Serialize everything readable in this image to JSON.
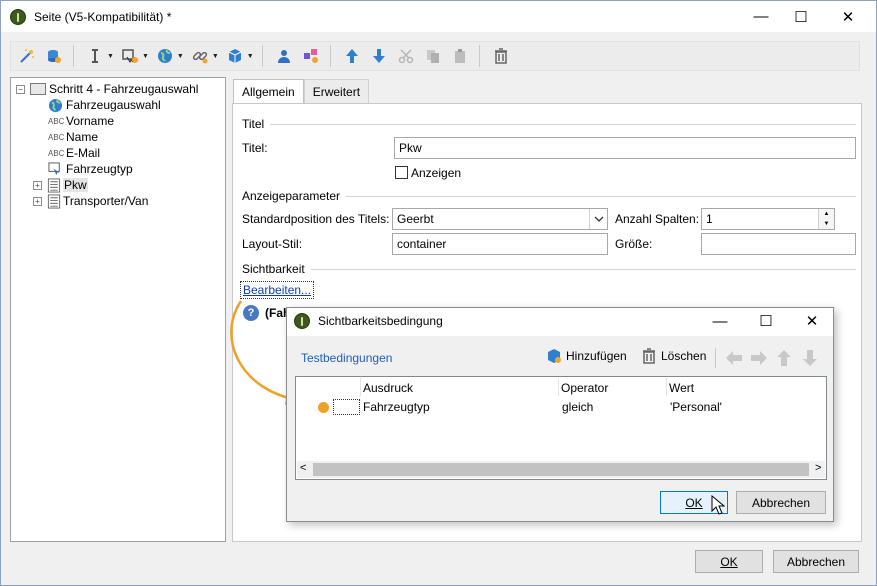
{
  "window": {
    "title": "Seite (V5-Kompatibilität) *",
    "minimize_glyph": "—",
    "maximize_glyph": "☐",
    "close_glyph": "✕"
  },
  "toolbar": {
    "icons": [
      "magic-wand-icon",
      "database-icon",
      "text-cursor-icon",
      "form-add-icon",
      "globe-icon",
      "link-icon",
      "package-icon",
      "user-icon",
      "component-add-icon",
      "arrow-up-icon",
      "arrow-down-icon",
      "cut-icon",
      "copy-icon",
      "paste-icon",
      "trash-icon"
    ]
  },
  "tree": {
    "root": {
      "label": "Schritt 4 - Fahrzeugauswahl",
      "expander": "−"
    },
    "items": [
      {
        "label": "Fahrzeugauswahl",
        "icon": "globe-icon"
      },
      {
        "label": "Vorname",
        "icon": "abc-icon",
        "abc": "ABC"
      },
      {
        "label": "Name",
        "icon": "abc-icon",
        "abc": "ABC"
      },
      {
        "label": "E-Mail",
        "icon": "abc-icon",
        "abc": "ABC"
      },
      {
        "label": "Fahrzeugtyp",
        "icon": "select-icon"
      },
      {
        "label": "Pkw",
        "icon": "list-icon",
        "expander": "+"
      },
      {
        "label": "Transporter/Van",
        "icon": "list-icon",
        "expander": "+"
      }
    ]
  },
  "tabs": [
    {
      "label": "Allgemein",
      "active": true
    },
    {
      "label": "Erweitert",
      "active": false
    }
  ],
  "form": {
    "group_titel": "Titel",
    "titel_label": "Titel:",
    "titel_value": "Pkw",
    "anzeigen_label": "Anzeigen",
    "anzeigen_checked": false,
    "group_anzeige": "Anzeigeparameter",
    "standardpos_label": "Standardposition des Titels:",
    "standardpos_value": "Geerbt",
    "anzahl_label": "Anzahl Spalten:",
    "anzahl_value": "1",
    "layout_label": "Layout-Stil:",
    "layout_value": "container",
    "groesse_label": "Größe:",
    "groesse_value": "",
    "group_sicht": "Sichtbarkeit",
    "bearbeiten_link": "Bearbeiten...",
    "info_text": "(Fah"
  },
  "dialog": {
    "title": "Sichtbarkeitsbedingung",
    "section": "Testbedingungen",
    "add_label": "Hinzufügen",
    "delete_label": "Löschen",
    "columns": [
      "Ausdruck",
      "Operator",
      "Wert"
    ],
    "rows": [
      {
        "ausdruck": "Fahrzeugtyp",
        "operator": "gleich",
        "wert": "'Personal'"
      }
    ],
    "ok_label": "OK",
    "cancel_label": "Abbrechen",
    "scroll_left": "<",
    "scroll_right": ">"
  },
  "footer": {
    "ok_label": "OK",
    "cancel_label": "Abbrechen"
  },
  "colors": {
    "accent": "#0078d7",
    "link": "#0a3db5",
    "arrow": "#f0a028",
    "group_line": "#d5d5d5"
  }
}
